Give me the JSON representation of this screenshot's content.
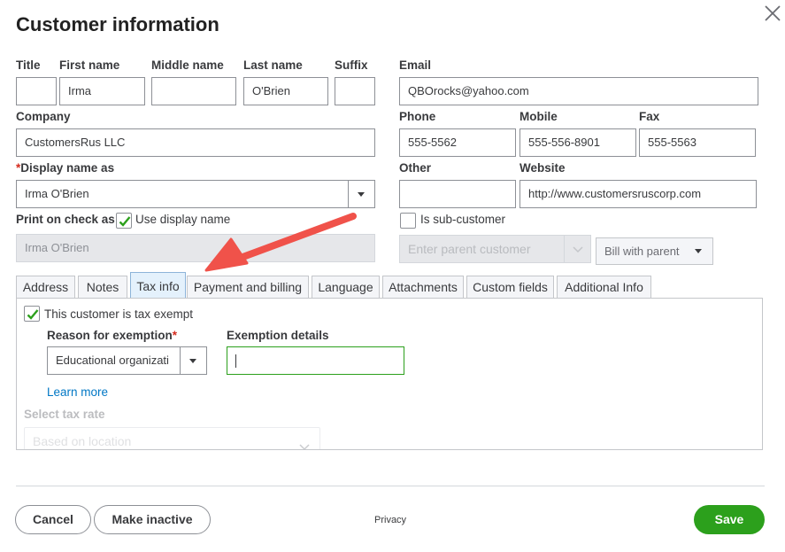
{
  "dialog": {
    "title": "Customer information"
  },
  "name_fields": {
    "title_label": "Title",
    "title_value": "",
    "first_label": "First name",
    "first_value": "Irma",
    "middle_label": "Middle name",
    "middle_value": "",
    "last_label": "Last name",
    "last_value": "O'Brien",
    "suffix_label": "Suffix",
    "suffix_value": ""
  },
  "company": {
    "label": "Company",
    "value": "CustomersRus LLC"
  },
  "display_name": {
    "required_mark": "*",
    "label": "Display name as",
    "value": "Irma O'Brien"
  },
  "print_on_check": {
    "label": "Print on check as",
    "use_display_label": "Use display name",
    "use_display_checked": true,
    "value": "Irma O'Brien"
  },
  "contact": {
    "email_label": "Email",
    "email_value": "QBOrocks@yahoo.com",
    "phone_label": "Phone",
    "phone_value": "555-5562",
    "mobile_label": "Mobile",
    "mobile_value": "555-556-8901",
    "fax_label": "Fax",
    "fax_value": "555-5563",
    "other_label": "Other",
    "other_value": "",
    "website_label": "Website",
    "website_value": "http://www.customersruscorp.com"
  },
  "sub_customer": {
    "label": "Is sub-customer",
    "checked": false,
    "parent_placeholder": "Enter parent customer",
    "billing_value": "Bill with parent"
  },
  "tabs": [
    {
      "label": "Address",
      "active": false
    },
    {
      "label": "Notes",
      "active": false
    },
    {
      "label": "Tax info",
      "active": true
    },
    {
      "label": "Payment and billing",
      "active": false
    },
    {
      "label": "Language",
      "active": false
    },
    {
      "label": "Attachments",
      "active": false
    },
    {
      "label": "Custom fields",
      "active": false
    },
    {
      "label": "Additional Info",
      "active": false
    }
  ],
  "tax_info": {
    "exempt_label": "This customer is tax exempt",
    "exempt_checked": true,
    "reason_label": "Reason for exemption",
    "reason_required_mark": "*",
    "reason_value": "Educational organizati",
    "details_label": "Exemption details",
    "details_value": "",
    "learn_more": "Learn more",
    "tax_rate_label": "Select tax rate",
    "tax_rate_value": "Based on location"
  },
  "footer": {
    "cancel_label": "Cancel",
    "inactive_label": "Make inactive",
    "privacy_label": "Privacy",
    "save_label": "Save"
  },
  "colors": {
    "accent_green": "#2ca01c",
    "link_blue": "#0077c5",
    "required_red": "#d52b1e",
    "annotation_arrow": "#f0524a"
  }
}
